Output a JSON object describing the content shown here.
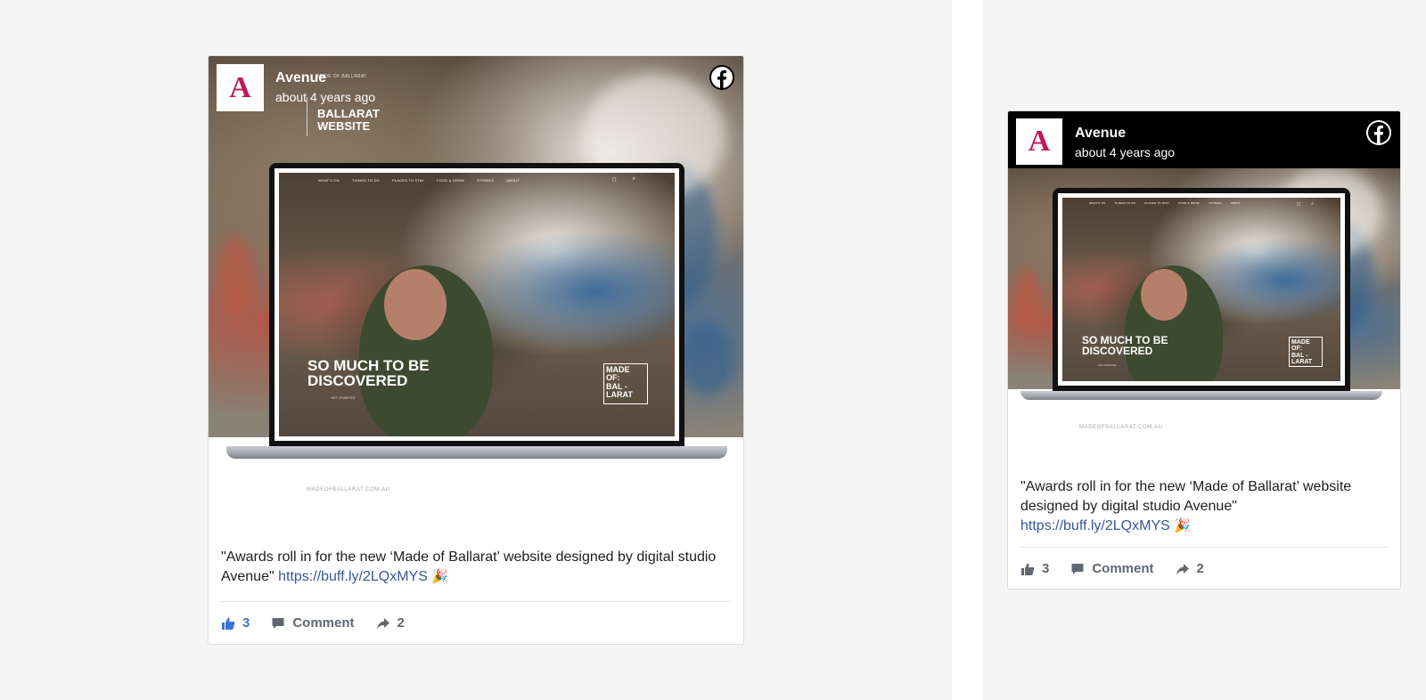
{
  "large_card": {
    "author": "Avenue",
    "time": "about 4 years ago",
    "overlay_small": "MADE OF BALLARAT",
    "overlay_title_line1": "BALLARAT",
    "overlay_title_line2": "WEBSITE",
    "site_nav": [
      "WHAT'S ON",
      "THINGS TO DO",
      "PLACES TO STAY",
      "FOOD & DRINK",
      "STORIES",
      "ABOUT"
    ],
    "hero_line1": "SO MUCH TO BE",
    "hero_line2": "DISCOVERED",
    "hero_sub": "GET STARTED",
    "badge_line1": "MADE",
    "badge_line2": "OF:",
    "badge_line3": "BAL -",
    "badge_line4": "LARAT",
    "url_caption": "MADEOFBALLARAT.COM.AU",
    "text": "\"Awards roll in for the new ‘Made of Ballarat’ website designed by digital studio Avenue\" ",
    "link": "https://buff.ly/2LQxMYS",
    "emoji": "🎉",
    "likes": "3",
    "comment_label": "Comment",
    "shares": "2"
  },
  "small_card": {
    "author": "Avenue",
    "time": "about 4 years ago",
    "site_nav": [
      "WHAT'S ON",
      "THINGS TO DO",
      "PLACES TO STAY",
      "FOOD & DRINK",
      "STORIES",
      "ABOUT"
    ],
    "hero_line1": "SO MUCH TO BE",
    "hero_line2": "DISCOVERED",
    "hero_sub": "GET STARTED",
    "badge_line1": "MADE",
    "badge_line2": "OF:",
    "badge_line3": "BAL -",
    "badge_line4": "LARAT",
    "url_caption": "MADEOFBALLARAT.COM.AU",
    "text": "\"Awards roll in for the new ‘Made of Ballarat’ website designed by digital studio Avenue\" ",
    "link": "https://buff.ly/2LQxMYS",
    "emoji": "🎉",
    "likes": "3",
    "comment_label": "Comment",
    "shares": "2"
  },
  "colors": {
    "brand_magenta": "#c0175d",
    "link_blue": "#385898",
    "like_blue": "#3a73d6",
    "action_gray": "#606770"
  },
  "icons": {
    "facebook": "facebook-icon",
    "like": "thumbs-up-icon",
    "comment": "comment-icon",
    "share": "share-arrow-icon"
  }
}
